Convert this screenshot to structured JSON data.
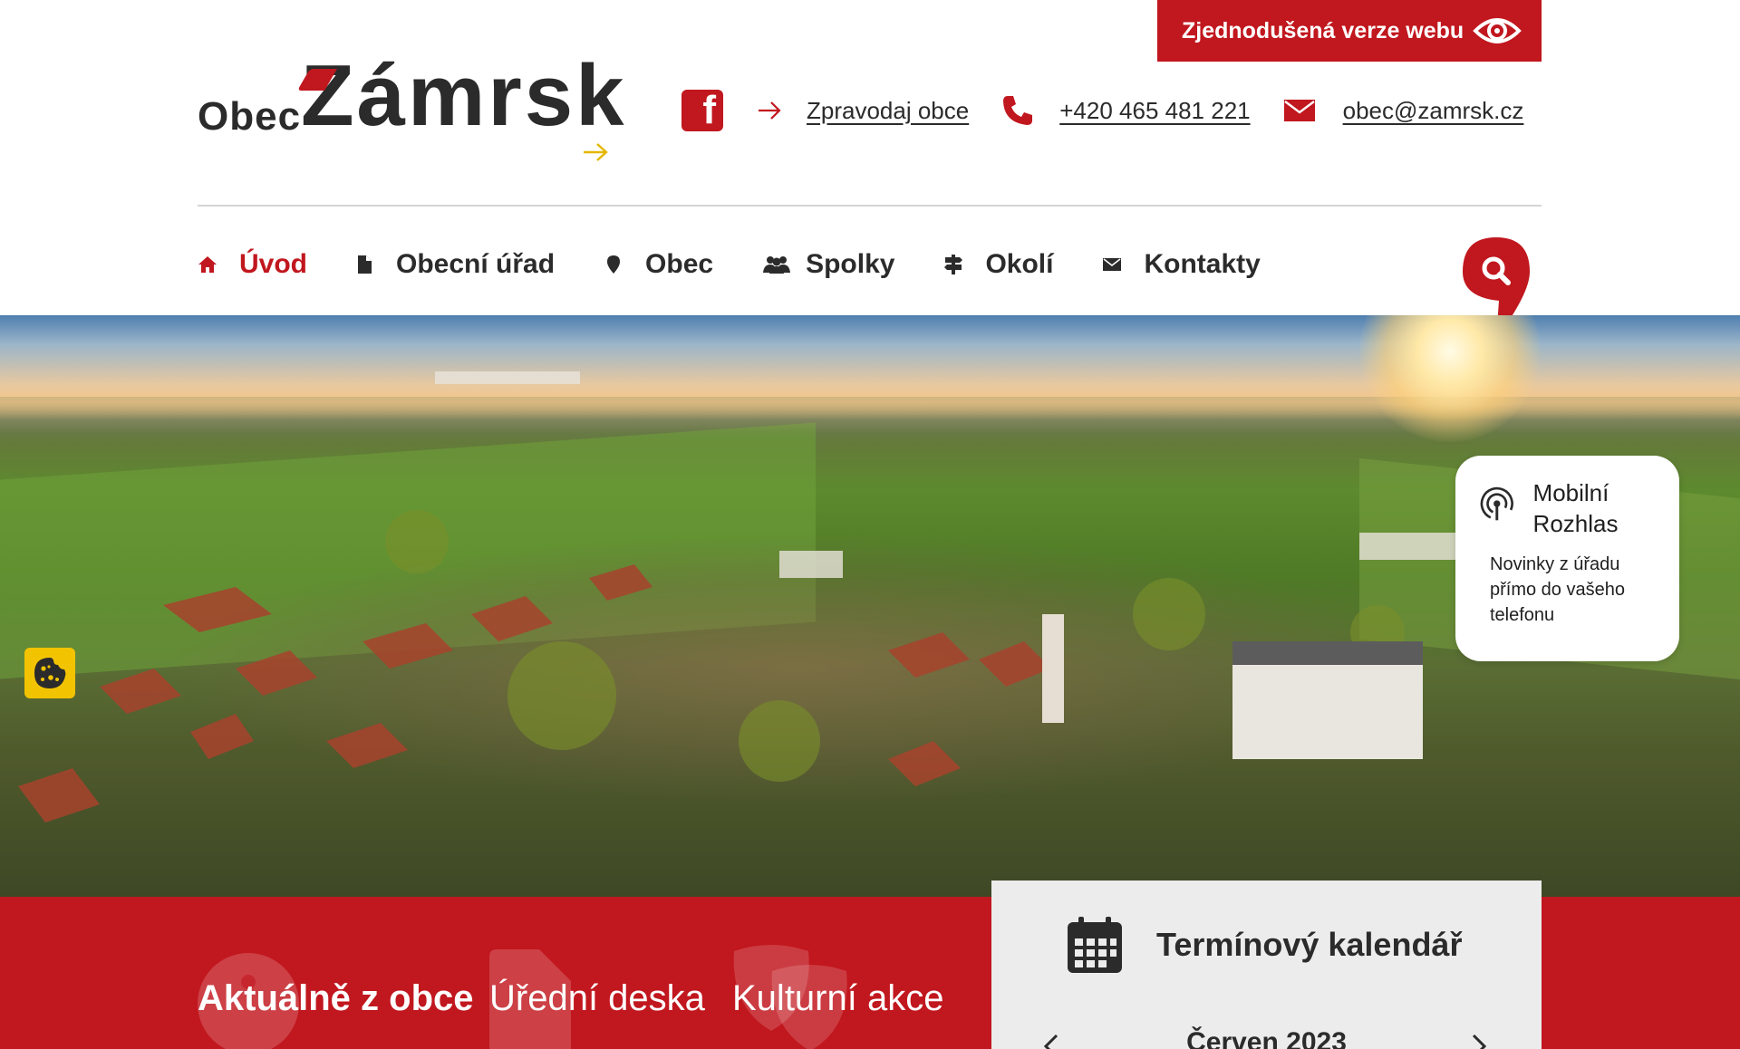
{
  "top_bar": {
    "simplified_label": "Zjednodušená verze webu"
  },
  "logo": {
    "prefix": "Obec",
    "name": "Zámrsk"
  },
  "header": {
    "facebook_letter": "f",
    "newsletter_label": "Zpravodaj obce",
    "phone": "+420 465 481 221",
    "email": "obec@zamrsk.cz"
  },
  "nav": {
    "items": [
      {
        "label": "Úvod",
        "icon": "home-icon",
        "active": true
      },
      {
        "label": "Obecní úřad",
        "icon": "document-icon"
      },
      {
        "label": "Obec",
        "icon": "pin-icon"
      },
      {
        "label": "Spolky",
        "icon": "people-icon"
      },
      {
        "label": "Okolí",
        "icon": "signpost-icon"
      },
      {
        "label": "Kontakty",
        "icon": "envelope-icon"
      }
    ]
  },
  "mobile_radio": {
    "title": "Mobilní Rozhlas",
    "text": "Novinky z úřadu přímo do vašeho telefonu"
  },
  "tabs": [
    {
      "label": "Aktuálně z obce",
      "active": true
    },
    {
      "label": "Úřední deska"
    },
    {
      "label": "Kulturní akce"
    }
  ],
  "calendar": {
    "title": "Termínový kalendář",
    "month": "Červen 2023"
  },
  "colors": {
    "brand_red": "#c1171e",
    "text_dark": "#2b2b2b",
    "cookie_yellow": "#f2c300",
    "calendar_bg": "#ececec"
  }
}
